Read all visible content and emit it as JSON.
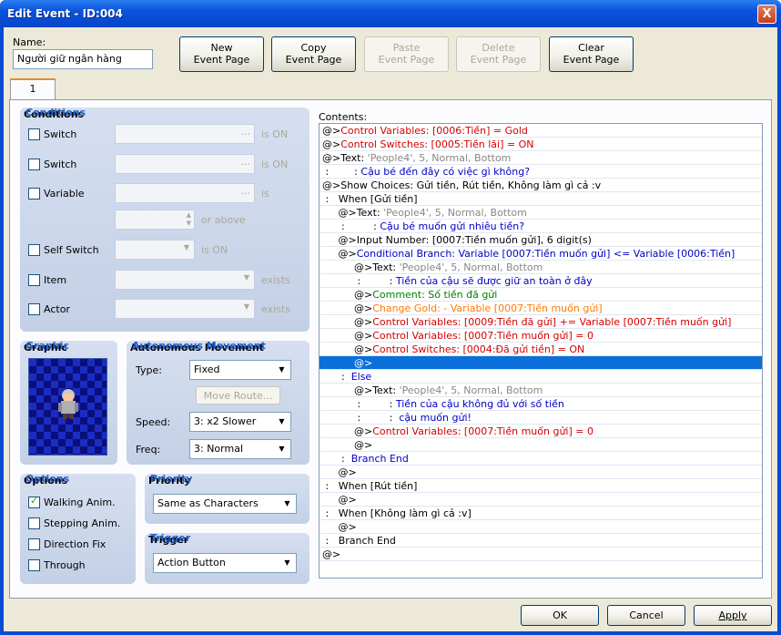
{
  "window": {
    "title": "Edit Event - ID:004",
    "close": "X"
  },
  "name": {
    "label": "Name:",
    "value": "Người giữ ngân hàng"
  },
  "page_buttons": [
    {
      "label": "New\nEvent Page",
      "enabled": true
    },
    {
      "label": "Copy\nEvent Page",
      "enabled": true
    },
    {
      "label": "Paste\nEvent Page",
      "enabled": false
    },
    {
      "label": "Delete\nEvent Page",
      "enabled": false
    },
    {
      "label": "Clear\nEvent Page",
      "enabled": true
    }
  ],
  "tabs": [
    {
      "label": "1"
    }
  ],
  "conditions": {
    "title": "Conditions",
    "switch1": "Switch",
    "switch1_suffix": "is ON",
    "switch2": "Switch",
    "switch2_suffix": "is ON",
    "variable": "Variable",
    "variable_suffix": "is",
    "variable_above": "or above",
    "self_switch": "Self Switch",
    "self_switch_suffix": "is ON",
    "item": "Item",
    "item_suffix": "exists",
    "actor": "Actor",
    "actor_suffix": "exists",
    "ellipsis": "..."
  },
  "graphic": {
    "title": "Graphic"
  },
  "movement": {
    "title": "Autonomous Movement",
    "type_label": "Type:",
    "type_value": "Fixed",
    "move_route": "Move Route...",
    "speed_label": "Speed:",
    "speed_value": "3: x2 Slower",
    "freq_label": "Freq:",
    "freq_value": "3: Normal"
  },
  "options": {
    "title": "Options",
    "walking": "Walking Anim.",
    "stepping": "Stepping Anim.",
    "direction_fix": "Direction Fix",
    "through": "Through"
  },
  "priority": {
    "title": "Priority",
    "value": "Same as Characters"
  },
  "trigger": {
    "title": "Trigger",
    "value": "Action Button"
  },
  "contents": {
    "label": "Contents:",
    "lines": [
      {
        "indent": "",
        "prefix": "@>",
        "text": "Control Variables: [0006:Tiền] = Gold",
        "color": "red"
      },
      {
        "indent": "",
        "prefix": "@>",
        "text": "Control Switches: [0005:Tiền lãi] = ON",
        "color": "red"
      },
      {
        "indent": "",
        "prefix": "@>",
        "text": "Text: 'People4', 5, Normal, Bottom",
        "color": "blk"
      },
      {
        "indent": "",
        "prefix": " :        : ",
        "text": "Cậu bé đến đây có việc gì không?",
        "color": "blu"
      },
      {
        "indent": "",
        "prefix": "@>",
        "text": "Show Choices: Gửi tiền, Rút tiền, Không làm gì cả :v",
        "color": "blk"
      },
      {
        "indent": "",
        "prefix": " :   ",
        "text": "When [Gửi tiền]",
        "color": "blk"
      },
      {
        "indent": "     ",
        "prefix": "@>",
        "text": "Text: 'People4', 5, Normal, Bottom",
        "color": "blk"
      },
      {
        "indent": "      ",
        "prefix": ":         : ",
        "text": "Cậu bé muốn gửi nhiêu tiền?",
        "color": "blu"
      },
      {
        "indent": "     ",
        "prefix": "@>",
        "text": "Input Number: [0007:Tiền muốn gửi], 6 digit(s)",
        "color": "blk"
      },
      {
        "indent": "     ",
        "prefix": "@>",
        "text": "Conditional Branch: Variable [0007:Tiền muốn gửi] <= Variable [0006:Tiền]",
        "color": "blu"
      },
      {
        "indent": "          ",
        "prefix": "@>",
        "text": "Text: 'People4', 5, Normal, Bottom",
        "color": "blk"
      },
      {
        "indent": "           ",
        "prefix": ":         : ",
        "text": "Tiền của cậu sẽ được giữ an toàn ở đây",
        "color": "blu"
      },
      {
        "indent": "          ",
        "prefix": "@>",
        "text": "Comment: Số tiền đã gửi",
        "color": "grn"
      },
      {
        "indent": "          ",
        "prefix": "@>",
        "text": "Change Gold: - Variable [0007:Tiền muốn gửi]",
        "color": "org"
      },
      {
        "indent": "          ",
        "prefix": "@>",
        "text": "Control Variables: [0009:Tiền đã gửi] += Variable [0007:Tiền muốn gửi]",
        "color": "red"
      },
      {
        "indent": "          ",
        "prefix": "@>",
        "text": "Control Variables: [0007:Tiền muốn gửi] = 0",
        "color": "red"
      },
      {
        "indent": "          ",
        "prefix": "@>",
        "text": "Control Switches: [0004:Đã gửi tiền] = ON",
        "color": "red"
      },
      {
        "indent": "          ",
        "prefix": "@>",
        "text": "",
        "color": "blk",
        "selected": true
      },
      {
        "indent": "      ",
        "prefix": ":  ",
        "text": "Else",
        "color": "blu"
      },
      {
        "indent": "          ",
        "prefix": "@>",
        "text": "Text: 'People4', 5, Normal, Bottom",
        "color": "blk"
      },
      {
        "indent": "           ",
        "prefix": ":         : ",
        "text": "Tiền của cậu không đủ với số tiền",
        "color": "blu"
      },
      {
        "indent": "           ",
        "prefix": ":         :  ",
        "text": "cậu muốn gửi!",
        "color": "blu"
      },
      {
        "indent": "          ",
        "prefix": "@>",
        "text": "Control Variables: [0007:Tiền muốn gửi] = 0",
        "color": "red"
      },
      {
        "indent": "          ",
        "prefix": "@>",
        "text": "",
        "color": "blk"
      },
      {
        "indent": "      ",
        "prefix": ":  ",
        "text": "Branch End",
        "color": "blu"
      },
      {
        "indent": "     ",
        "prefix": "@>",
        "text": "",
        "color": "blk"
      },
      {
        "indent": "",
        "prefix": " :   ",
        "text": "When [Rút tiền]",
        "color": "blk"
      },
      {
        "indent": "     ",
        "prefix": "@>",
        "text": "",
        "color": "blk"
      },
      {
        "indent": "",
        "prefix": " :   ",
        "text": "When [Không làm gì cả :v]",
        "color": "blk"
      },
      {
        "indent": "     ",
        "prefix": "@>",
        "text": "",
        "color": "blk"
      },
      {
        "indent": "",
        "prefix": " :   ",
        "text": "Branch End",
        "color": "blk"
      },
      {
        "indent": "",
        "prefix": "@>",
        "text": "",
        "color": "blk"
      }
    ]
  },
  "footer": {
    "ok": "OK",
    "cancel": "Cancel",
    "apply": "Apply"
  }
}
